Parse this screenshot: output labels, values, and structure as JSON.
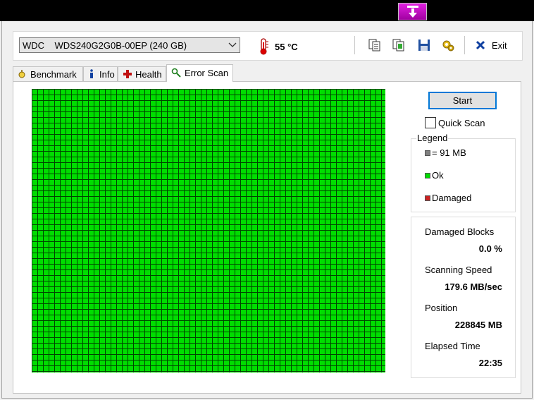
{
  "toolbar": {
    "drive_label": "WDC    WDS240G2G0B-00EP (240 GB)",
    "temperature": "55 °C",
    "exit_label": "Exit"
  },
  "tabs": [
    {
      "label": "Benchmark",
      "icon": "stopwatch-icon"
    },
    {
      "label": "Info",
      "icon": "info-icon"
    },
    {
      "label": "Health",
      "icon": "health-cross-icon"
    },
    {
      "label": "Error Scan",
      "icon": "magnifier-icon",
      "active": true
    }
  ],
  "scan": {
    "start_label": "Start",
    "quick_scan_label": "Quick Scan",
    "quick_scan_checked": false,
    "block_colors": {
      "ok": "#00dd00",
      "pending": "#808080",
      "damaged": "#cc2222"
    },
    "blocks_ok_fraction": 1.0
  },
  "legend": {
    "title": "Legend",
    "items": [
      {
        "label": "= 91 MB",
        "color": "#808080"
      },
      {
        "label": "Ok",
        "color": "#00dd00"
      },
      {
        "label": "Damaged",
        "color": "#cc2222"
      }
    ]
  },
  "stats": {
    "damaged_blocks_label": "Damaged Blocks",
    "damaged_blocks_value": "0.0 %",
    "scanning_speed_label": "Scanning Speed",
    "scanning_speed_value": "179.6 MB/sec",
    "position_label": "Position",
    "position_value": "228845 MB",
    "elapsed_time_label": "Elapsed Time",
    "elapsed_time_value": "22:35"
  }
}
